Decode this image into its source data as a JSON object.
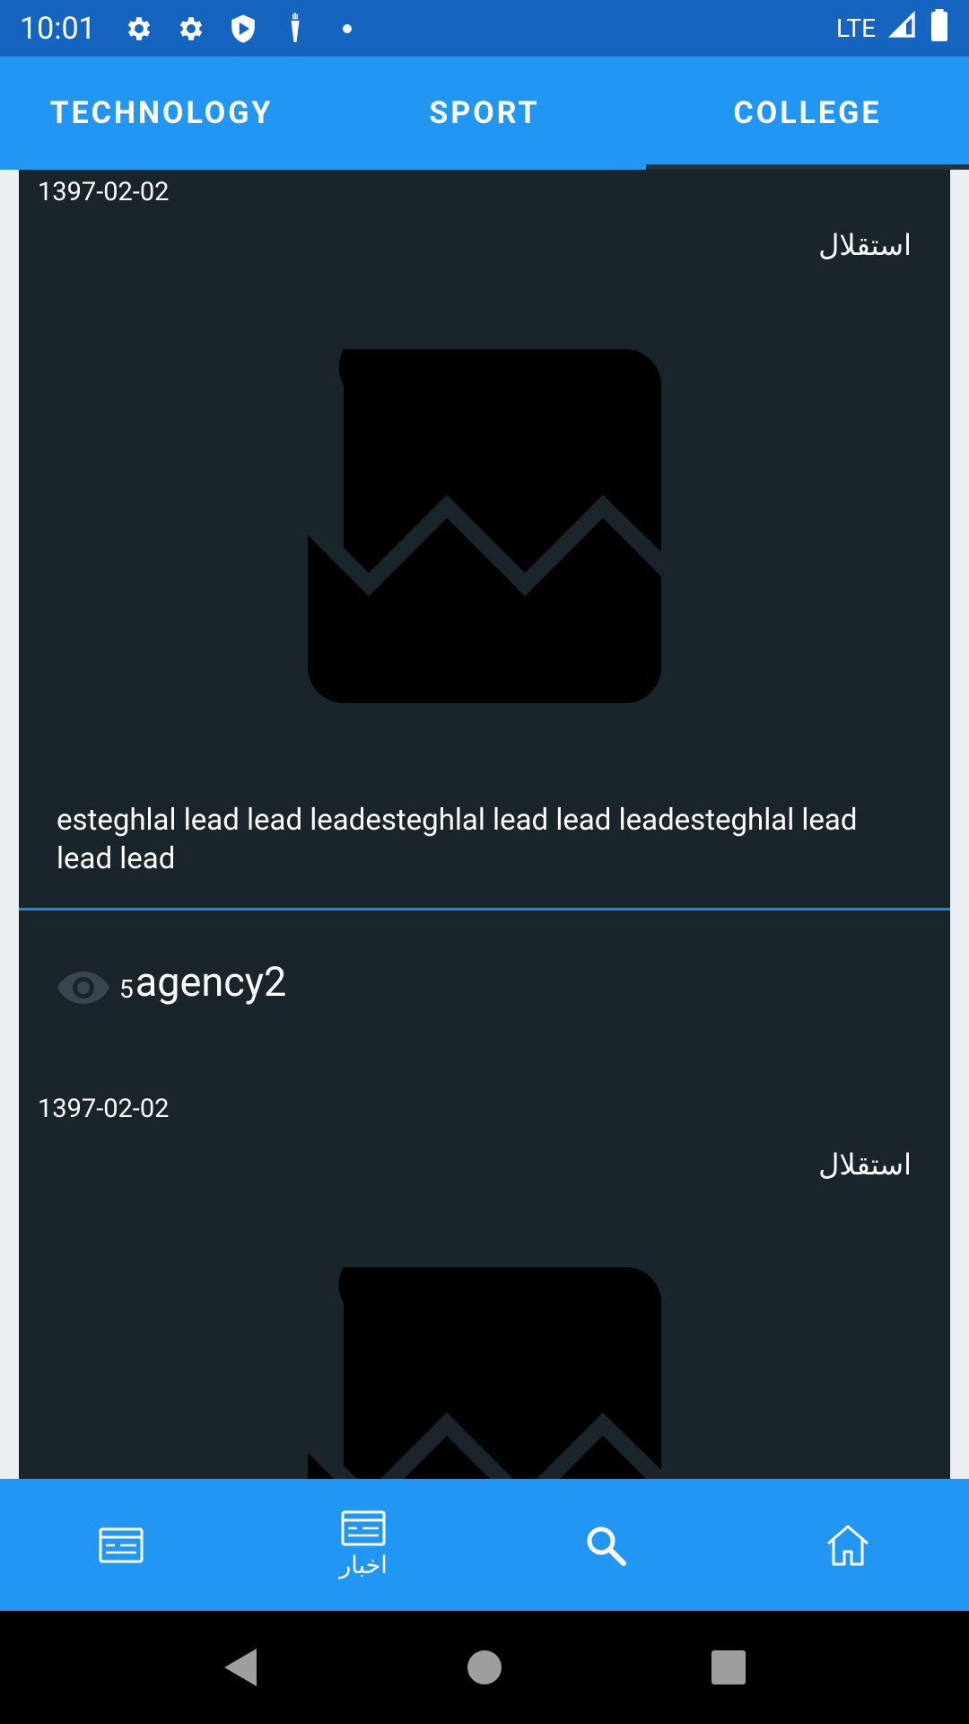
{
  "status_bar": {
    "time": "10:01",
    "network": "LTE",
    "icons": [
      "gear-icon",
      "gear-icon",
      "shield-icon",
      "carrot-icon",
      "dot-icon",
      "signal-icon",
      "battery-icon"
    ]
  },
  "tabs": [
    {
      "label": "TECHNOLOGY",
      "active": false
    },
    {
      "label": "SPORT",
      "active": false
    },
    {
      "label": "COLLEGE",
      "active": true
    }
  ],
  "cards": [
    {
      "date": "1397-02-02",
      "tag": "استقلال",
      "image_icon": "broken-image-icon",
      "lead": "esteghlal lead lead leadesteghlal lead lead leadesteghlal lead lead lead",
      "views": "5",
      "agency": "agency2"
    },
    {
      "date": "1397-02-02",
      "tag": "استقلال",
      "image_icon": "broken-image-icon"
    }
  ],
  "bottom_nav": [
    {
      "icon": "news-list-icon",
      "label": ""
    },
    {
      "icon": "news-list-icon",
      "label": "اخبار"
    },
    {
      "icon": "search-icon",
      "label": ""
    },
    {
      "icon": "home-icon",
      "label": ""
    }
  ],
  "colors": {
    "status_bar": "#1565c0",
    "primary": "#2196f3",
    "card_bg": "#1a252b",
    "accent_divider": "#1e88e5",
    "page_bg": "#eceff1"
  }
}
